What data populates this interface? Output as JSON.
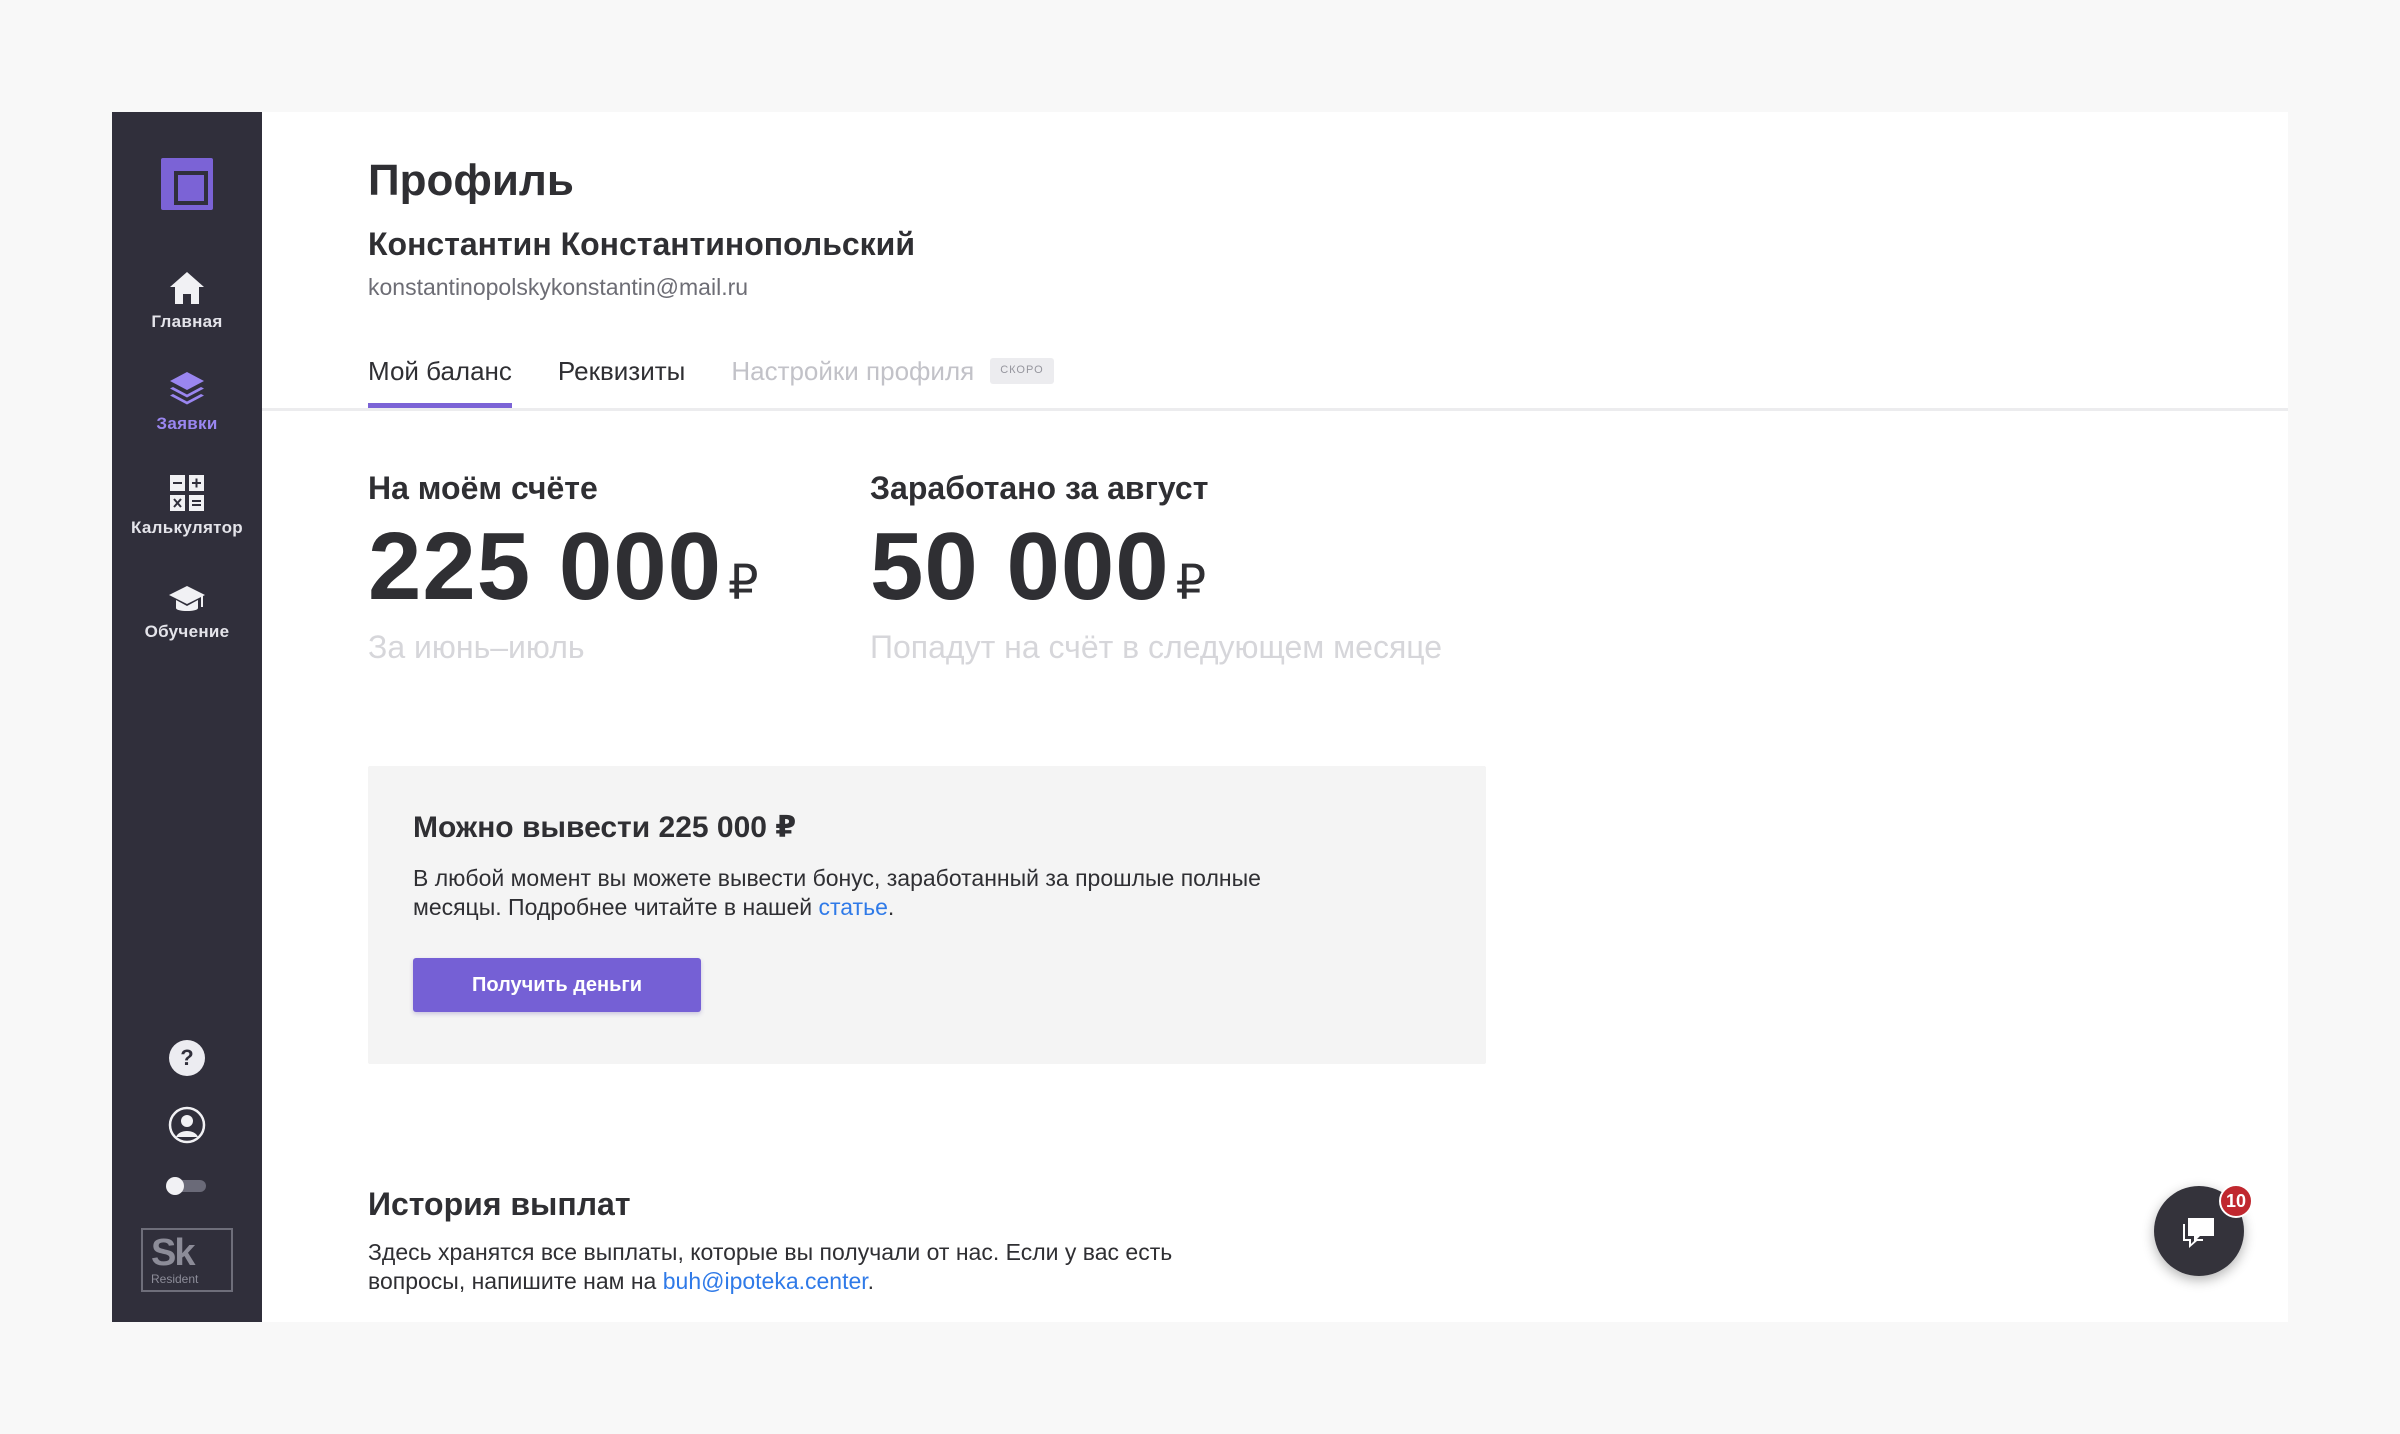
{
  "sidebar": {
    "items": [
      {
        "label": "Главная",
        "icon": "home-icon"
      },
      {
        "label": "Заявки",
        "icon": "layers-icon",
        "active": true
      },
      {
        "label": "Калькулятор",
        "icon": "calculator-icon"
      },
      {
        "label": "Обучение",
        "icon": "graduation-cap-icon"
      }
    ],
    "help_glyph": "?",
    "badge": {
      "brand": "Sk",
      "caption": "Resident"
    }
  },
  "profile": {
    "title": "Профиль",
    "name": "Константин Константинопольский",
    "email": "konstantinopolskykonstantin@mail.ru"
  },
  "tabs": [
    {
      "label": "Мой баланс",
      "active": true
    },
    {
      "label": "Реквизиты"
    },
    {
      "label": "Настройки профиля",
      "disabled": true,
      "badge": "СКОРО"
    }
  ],
  "balance": {
    "caption": "На моём счёте",
    "amount": "225 000",
    "currency": "₽",
    "period": "За июнь–июль"
  },
  "earned": {
    "caption": "Заработано за август",
    "amount": "50 000",
    "currency": "₽",
    "note": "Попадут на счёт в следующем месяце"
  },
  "withdraw": {
    "title": "Можно вывести 225 000 ₽",
    "text_before": "В любой момент вы можете вывести бонус, заработанный за прошлые полные месяцы. Подробнее читайте в нашей ",
    "link": "статье",
    "text_after": ".",
    "button": "Получить деньги"
  },
  "history": {
    "title": "История выплат",
    "text_before": "Здесь хранятся все выплаты, которые вы получали от нас. Если у вас есть вопросы, напишите нам на ",
    "email": "buh@ipoteka.center",
    "text_after": "."
  },
  "chat": {
    "unread": "10"
  },
  "colors": {
    "accent": "#7b63d6",
    "sidebar_bg": "#302f3b",
    "link": "#2f7ae8",
    "badge_red": "#c0282f"
  }
}
